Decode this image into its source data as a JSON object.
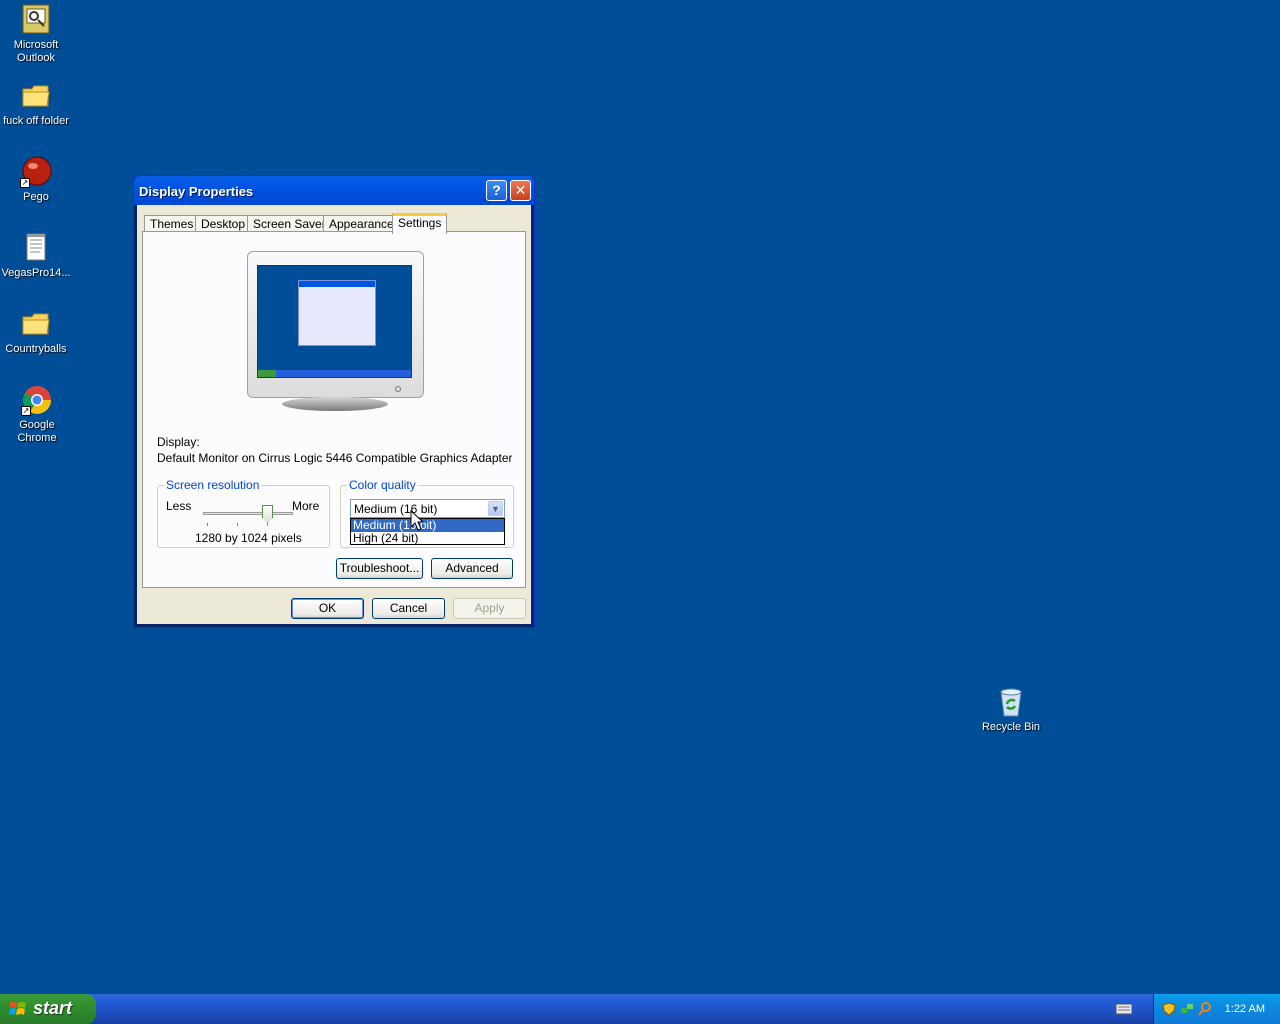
{
  "desktop": {
    "icons": [
      {
        "label": "Microsoft Outlook"
      },
      {
        "label": "fuck off folder"
      },
      {
        "label": "Pego"
      },
      {
        "label": "VegasPro14..."
      },
      {
        "label": "Countryballs"
      },
      {
        "label": "Google Chrome"
      },
      {
        "label": "Recycle Bin"
      }
    ]
  },
  "window": {
    "title": "Display Properties",
    "tabs": [
      "Themes",
      "Desktop",
      "Screen Saver",
      "Appearance",
      "Settings"
    ],
    "active_tab": "Settings",
    "display_label": "Display:",
    "display_value": "Default Monitor on Cirrus Logic 5446 Compatible Graphics Adapter",
    "screen_resolution": {
      "title": "Screen resolution",
      "less": "Less",
      "more": "More",
      "value_text": "1280 by 1024 pixels"
    },
    "color_quality": {
      "title": "Color quality",
      "selected": "Medium (16 bit)",
      "options": [
        "Medium (16 bit)",
        "High (24 bit)"
      ],
      "highlighted": "Medium (16 bit)"
    },
    "buttons": {
      "troubleshoot": "Troubleshoot...",
      "advanced": "Advanced",
      "ok": "OK",
      "cancel": "Cancel",
      "apply": "Apply"
    }
  },
  "taskbar": {
    "start_label": "start",
    "clock": "1:22 AM"
  },
  "colors": {
    "desktop": "#004e98",
    "titlebar": "#0054e3",
    "selection": "#316ac5"
  }
}
